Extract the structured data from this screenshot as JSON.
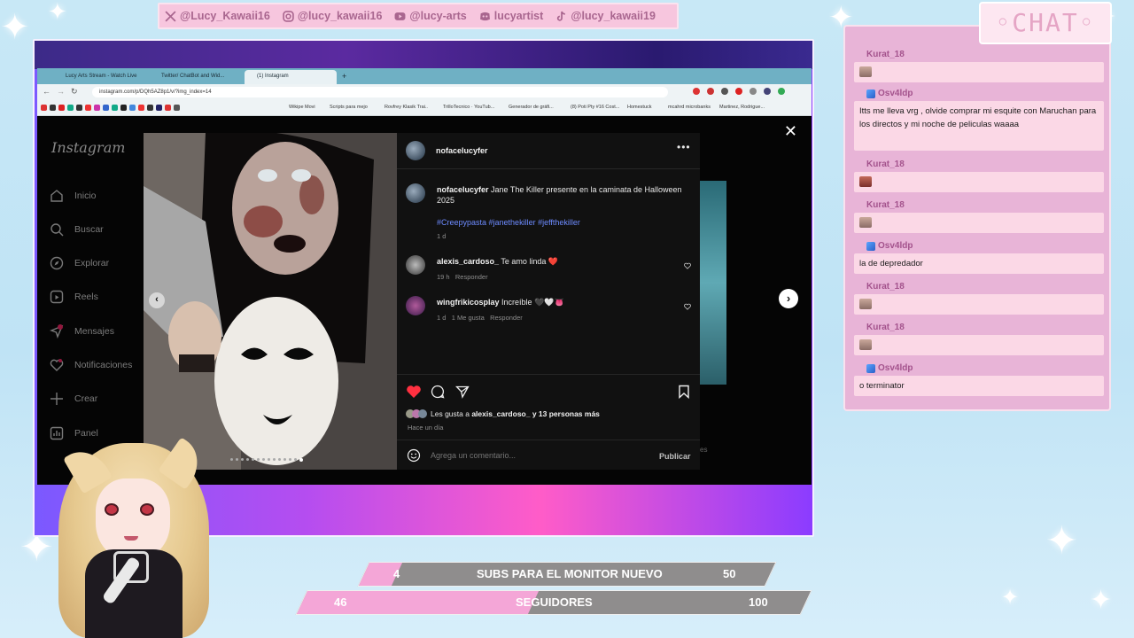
{
  "social": [
    {
      "icon": "x-icon",
      "label": "@Lucy_Kawaii16"
    },
    {
      "icon": "instagram-icon",
      "label": "@lucy_kawaii16"
    },
    {
      "icon": "youtube-icon",
      "label": "@lucy-arts"
    },
    {
      "icon": "discord-icon",
      "label": "lucyartist"
    },
    {
      "icon": "tiktok-icon",
      "label": "@lucy_kawaii19"
    }
  ],
  "browser": {
    "tabs": [
      "Lucy Arts Stream - Watch Live",
      "Twitter/ ChatBot and Wid...",
      "(1) Instagram"
    ],
    "url": "instagram.com/p/DQh5AZ8p1/v/?img_index=14",
    "bookmarks": [
      "Wikipe Movi",
      "Scripts para mejo",
      "Rovfrey Klasik Trai..",
      "TrilloTecnico · YouTub...",
      "Generador de gráfi...",
      "(8) Poti Pty #16 Cost...",
      "Homestuck",
      "mcahrd microbanks",
      "Martinez, Rodrigue..."
    ]
  },
  "instagram": {
    "logo": "Instagram",
    "nav": [
      {
        "icon": "home-icon",
        "label": "Inicio"
      },
      {
        "icon": "search-icon",
        "label": "Buscar"
      },
      {
        "icon": "compass-icon",
        "label": "Explorar"
      },
      {
        "icon": "reels-icon",
        "label": "Reels"
      },
      {
        "icon": "messages-icon",
        "label": "Mensajes",
        "badge": "2"
      },
      {
        "icon": "heart-icon",
        "label": "Notificaciones"
      },
      {
        "icon": "plus-icon",
        "label": "Crear"
      },
      {
        "icon": "dashboard-icon",
        "label": "Panel"
      }
    ],
    "post": {
      "author": "nofacelucyfer",
      "caption_user": "nofacelucyfer",
      "caption": "Jane The Killer presente en la caminata de Halloween 2025",
      "tags": "#Creepypasta #janethekiller #jeffthekiller",
      "caption_time": "1 d",
      "comments": [
        {
          "user": "alexis_cardoso_",
          "text": "Te amo linda ❤️",
          "time": "19 h",
          "likes": "",
          "reply": "Responder"
        },
        {
          "user": "wingfrikicosplay",
          "text": "Increíble 🖤🤍👅",
          "time": "1 d",
          "likes": "1 Me gusta",
          "reply": "Responder"
        }
      ],
      "liked_by": "Les gusta a ",
      "liked_user": "alexis_cardoso_",
      "liked_rest": " y 13 personas más",
      "posted_ago": "Hace un día",
      "comment_placeholder": "Agrega un comentario...",
      "publish": "Publicar",
      "side_text": "es"
    }
  },
  "chat": {
    "title": "◦CHAT◦",
    "messages": [
      {
        "user": "Kurat_18",
        "badge": false,
        "text": "",
        "emote": true
      },
      {
        "user": "Osv4ldp",
        "badge": true,
        "text": "Itts me lleva vrg , olvide comprar mi esquite con Maruchan para los directos y mi noche de peliculas waaaa",
        "emote": false
      },
      {
        "user": "Kurat_18",
        "badge": false,
        "text": "",
        "emote": true
      },
      {
        "user": "Kurat_18",
        "badge": false,
        "text": "",
        "emote": true
      },
      {
        "user": "Osv4ldp",
        "badge": true,
        "text": "la de depredador",
        "emote": false
      },
      {
        "user": "Kurat_18",
        "badge": false,
        "text": "",
        "emote": true
      },
      {
        "user": "Kurat_18",
        "badge": false,
        "text": "",
        "emote": true
      },
      {
        "user": "Osv4ldp",
        "badge": true,
        "text": "o terminator",
        "emote": false
      }
    ]
  },
  "goals": [
    {
      "current": "4",
      "label": "SUBS PARA EL MONITOR NUEVO",
      "target": "50",
      "progress": 0.08
    },
    {
      "current": "46",
      "label": "SEGUIDORES",
      "target": "100",
      "progress": 0.46
    }
  ]
}
